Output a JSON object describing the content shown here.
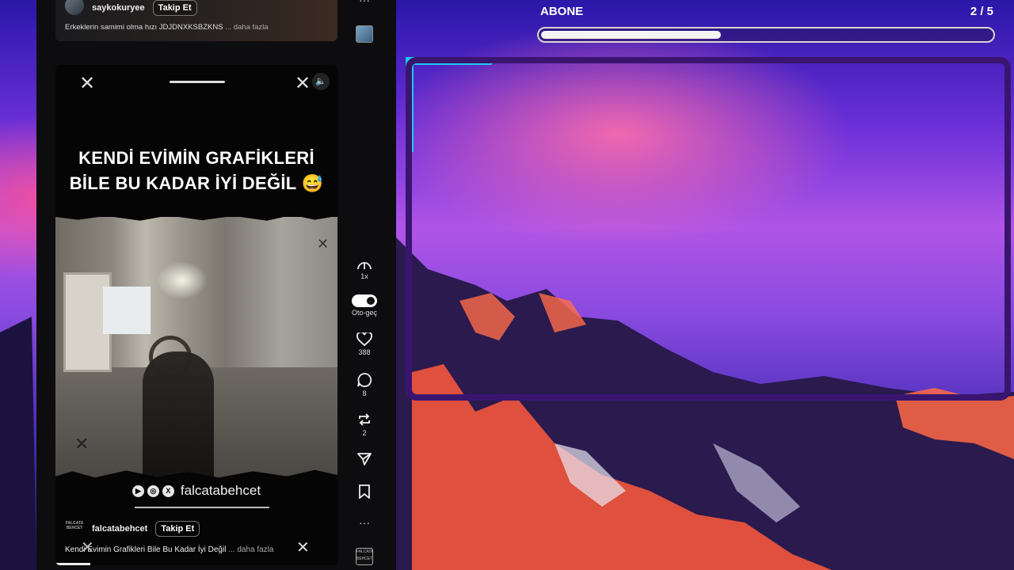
{
  "goal": {
    "title": "ABONE",
    "count": "2 / 5",
    "progress_fraction": 0.4
  },
  "prev_post": {
    "username": "saykokuryee",
    "follow_label": "Takip Et",
    "caption": "Erkeklerin samimi olma hızı JDJDNXKSBZKNS",
    "more_label": "... daha fazla"
  },
  "video_post": {
    "headline_line1": "KENDİ EVİMİN GRAFİKLERİ",
    "headline_line2": "BİLE BU KADAR İYİ DEĞİL 😅",
    "social_handle": "falcatabehcet",
    "username": "falcatabehcet",
    "brand_logo_text": "FALCATA BEHCET",
    "follow_label": "Takip Et",
    "caption": "Kendi Evimin Grafikleri Bile Bu Kadar İyi Değil",
    "more_label": "... daha fazla",
    "close_glyph": "✕",
    "mute_glyph": "🔈"
  },
  "rail": {
    "more_glyph": "···",
    "speed_label": "1x",
    "autoplay_label": "Oto-geç",
    "likes": "388",
    "comments": "8",
    "reposts": "2",
    "bottom_logo_text": "FALCATA BEHCET"
  },
  "colors": {
    "panel": "#0d0d0f",
    "cam_border": "#3a1570",
    "cam_accent": "#1ec8f0"
  },
  "icons": [
    "more-icon",
    "speed-gauge-icon",
    "autoplay-toggle",
    "heart-icon",
    "comment-icon",
    "repost-icon",
    "share-icon",
    "bookmark-icon",
    "close-icon",
    "speaker-icon",
    "youtube-icon",
    "instagram-icon",
    "x-icon"
  ]
}
